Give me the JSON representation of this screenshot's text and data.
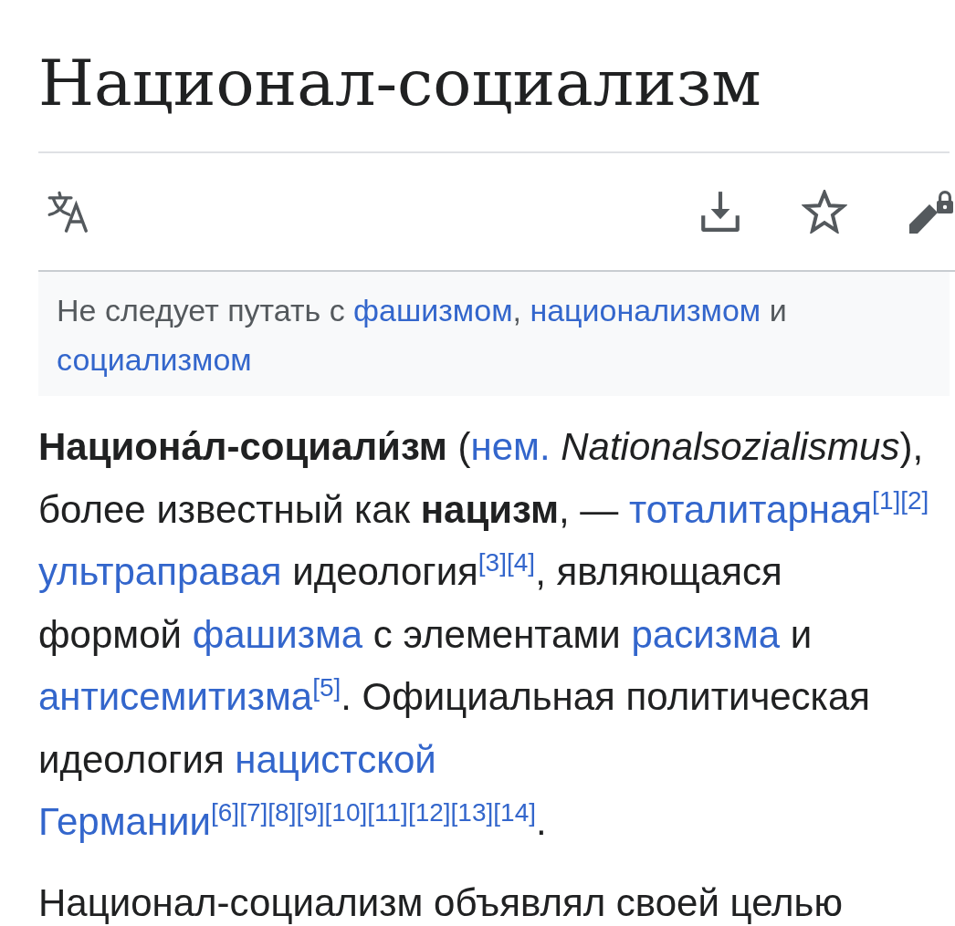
{
  "page": {
    "title": "Национал-социализм"
  },
  "toolbar": {
    "watched": false,
    "edit_protected": true
  },
  "hatnote": {
    "runs": [
      {
        "kind": "text",
        "text": "Не следует путать с "
      },
      {
        "kind": "link",
        "text": "фашизмом"
      },
      {
        "kind": "text",
        "text": ", "
      },
      {
        "kind": "link",
        "text": "национализмом"
      },
      {
        "kind": "text",
        "text": " и "
      },
      {
        "kind": "link",
        "text": "социализмом"
      }
    ]
  },
  "paragraphs": [
    {
      "runs": [
        {
          "kind": "text",
          "text": "**Национа́л-социали́зм** ("
        },
        {
          "kind": "link",
          "text": "нем."
        },
        {
          "kind": "text",
          "text": " *Nationalsozialismus*), более известный как **нацизм**, — "
        },
        {
          "kind": "link",
          "text": "тоталитарная"
        },
        {
          "kind": "ref",
          "text": "[1]"
        },
        {
          "kind": "ref",
          "text": "[2]"
        },
        {
          "kind": "space"
        },
        {
          "kind": "link",
          "text": "ультраправая"
        },
        {
          "kind": "text",
          "text": " идеология"
        },
        {
          "kind": "ref",
          "text": "[3]"
        },
        {
          "kind": "ref",
          "text": "[4]"
        },
        {
          "kind": "text",
          "text": ", являющаяся формой "
        },
        {
          "kind": "link",
          "text": "фашизма"
        },
        {
          "kind": "text",
          "text": " с элементами "
        },
        {
          "kind": "link",
          "text": "расизма"
        },
        {
          "kind": "text",
          "text": " и "
        },
        {
          "kind": "link",
          "text": "антисемитизма"
        },
        {
          "kind": "ref",
          "text": "[5]"
        },
        {
          "kind": "text",
          "text": ". Официальная политическая идеология "
        },
        {
          "kind": "link",
          "text": "нацистской"
        },
        {
          "kind": "space"
        },
        {
          "kind": "link",
          "text": "Германии"
        },
        {
          "kind": "ref",
          "text": "[6]"
        },
        {
          "kind": "ref",
          "text": "[7]"
        },
        {
          "kind": "ref",
          "text": "[8]"
        },
        {
          "kind": "ref",
          "text": "[9]"
        },
        {
          "kind": "ref",
          "text": "[10]"
        },
        {
          "kind": "ref",
          "text": "[11]"
        },
        {
          "kind": "ref",
          "text": "[12]"
        },
        {
          "kind": "ref",
          "text": "[13]"
        },
        {
          "kind": "ref",
          "text": "[14]"
        },
        {
          "kind": "text",
          "text": "."
        }
      ]
    },
    {
      "runs": [
        {
          "kind": "text",
          "text": "Национал-социализм объявлял своей целью"
        }
      ]
    }
  ]
}
